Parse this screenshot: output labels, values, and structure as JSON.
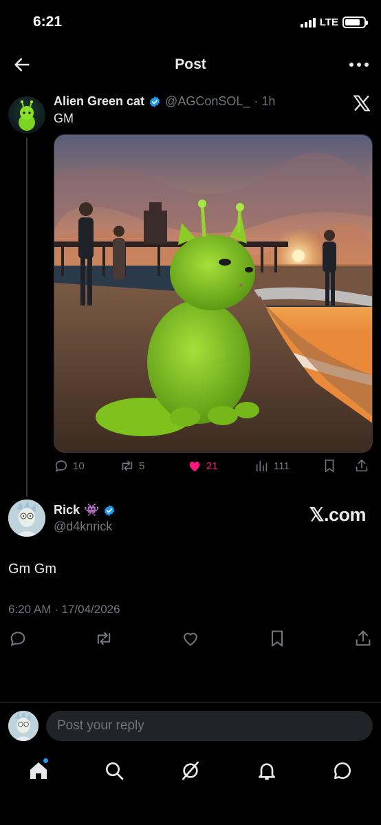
{
  "status_bar": {
    "time": "6:21",
    "network": "LTE"
  },
  "header": {
    "title": "Post"
  },
  "parent_post": {
    "author_name": "Alien Green cat",
    "handle": "@AGConSOL_",
    "time": "· 1h",
    "text": "GM",
    "replies": "10",
    "reposts": "5",
    "likes": "21",
    "views": "111"
  },
  "main_post": {
    "author_name": "Rick",
    "author_emoji": "👾",
    "handle": "@d4knrick",
    "brand": "𝕏.com",
    "text": "Gm Gm",
    "timestamp": "6:20 AM · 17/04/2026"
  },
  "reply_box": {
    "placeholder": "Post your reply"
  },
  "colors": {
    "like": "#f91880",
    "verified": "#1d9bf0",
    "muted": "#71767b",
    "text": "#e7e9ea"
  },
  "icons": [
    "back-arrow-icon",
    "more-icon",
    "x-logo-icon",
    "verified-icon",
    "reply-icon",
    "repost-icon",
    "heart-icon",
    "views-icon",
    "bookmark-icon",
    "share-icon",
    "home-icon",
    "search-icon",
    "grok-icon",
    "notifications-icon",
    "messages-icon"
  ]
}
